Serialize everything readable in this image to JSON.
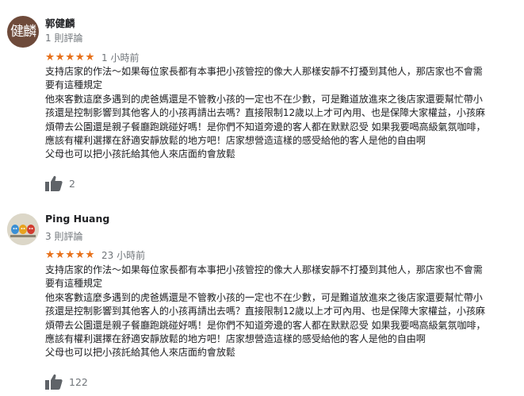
{
  "reviews": [
    {
      "avatar_text": "健麟",
      "name": "郭健麟",
      "review_count": "1 則評論",
      "stars": "★★★★★",
      "time": "1 小時前",
      "lines": [
        "支持店家的作法～如果每位家長都有本事把小孩管控的像大人那樣安靜不打擾到其他人，那店家也不會需",
        "要有這種規定",
        "他來客數這麼多遇到的虎爸媽還是不管教小孩的一定也不在少數，可是難道放進來之後店家還要幫忙帶小",
        "孩還是控制影響到其他客人的小孩再請出去嗎？直接限制12歲以上才可內用、也是保障大家權益，小孩麻",
        "煩帶去公園還是親子餐廳跑跳碰好嗎！是你們不知道旁邊的客人都在默默忍受 如果我要喝高級氣氛咖啡，",
        "應該有權利選擇在舒適安靜放鬆的地方吧！店家想營造這樣的感受給他的客人是他的自由啊",
        "父母也可以把小孩託給其他人來店面約會放鬆"
      ],
      "likes": "2"
    },
    {
      "avatar_icon": "cartoon-avatar",
      "name": "Ping Huang",
      "review_count": "3 則評論",
      "stars": "★★★★★",
      "time": "23 小時前",
      "lines": [
        "支持店家的作法～如果每位家長都有本事把小孩管控的像大人那樣安靜不打擾到其他人，那店家也不會需",
        "要有這種規定",
        "他來客數這麼多遇到的虎爸媽還是不管教小孩的一定也不在少數，可是難道放進來之後店家還要幫忙帶小",
        "孩還是控制影響到其他客人的小孩再請出去嗎？直接限制12歲以上才可內用、也是保障大家權益，小孩麻",
        "煩帶去公園還是親子餐廳跑跳碰好嗎！是你們不知道旁邊的客人都在默默忍受 如果我要喝高級氣氛咖啡，",
        "應該有權利選擇在舒適安靜放鬆的地方吧！店家想營造這樣的感受給他的客人是他的自由啊",
        "父母也可以把小孩託給其他人來店面約會放鬆"
      ],
      "likes": "122"
    }
  ],
  "colors": {
    "star": "#e7711b",
    "secondary_text": "#70757a",
    "primary_text": "#202124",
    "thumb": "#5f6368"
  }
}
